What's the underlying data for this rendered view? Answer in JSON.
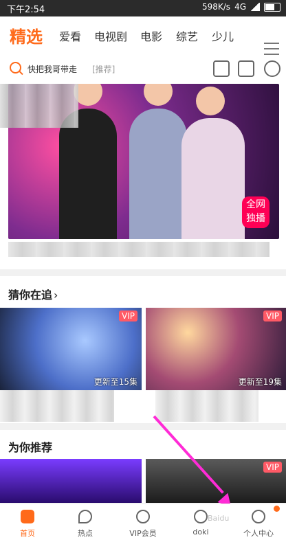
{
  "status_bar": {
    "time": "下午2:54",
    "speed": "598K/s",
    "network": "4G"
  },
  "top_tabs": {
    "items": [
      {
        "label": "精选",
        "active": true
      },
      {
        "label": "爱看"
      },
      {
        "label": "电视剧"
      },
      {
        "label": "电影"
      },
      {
        "label": "综艺"
      },
      {
        "label": "少儿"
      }
    ]
  },
  "search": {
    "text": "快把我哥带走",
    "hint": "[推荐]"
  },
  "banner": {
    "badge_line1": "全网",
    "badge_line2": "独播"
  },
  "sections": {
    "following_title": "猜你在追",
    "recommend_title": "为你推荐"
  },
  "following": {
    "items": [
      {
        "vip": "VIP",
        "episode": "更新至15集"
      },
      {
        "vip": "VIP",
        "episode": "更新至19集"
      }
    ]
  },
  "recommend": {
    "items": [
      {
        "vip": ""
      },
      {
        "vip": "VIP"
      }
    ]
  },
  "bottom_nav": {
    "items": [
      {
        "label": "首页",
        "active": true
      },
      {
        "label": "热点"
      },
      {
        "label": "VIP会员"
      },
      {
        "label": "doki"
      },
      {
        "label": "个人中心"
      }
    ]
  },
  "colors": {
    "accent": "#ff6a1a",
    "annotation_arrow": "#ff2bd6"
  }
}
